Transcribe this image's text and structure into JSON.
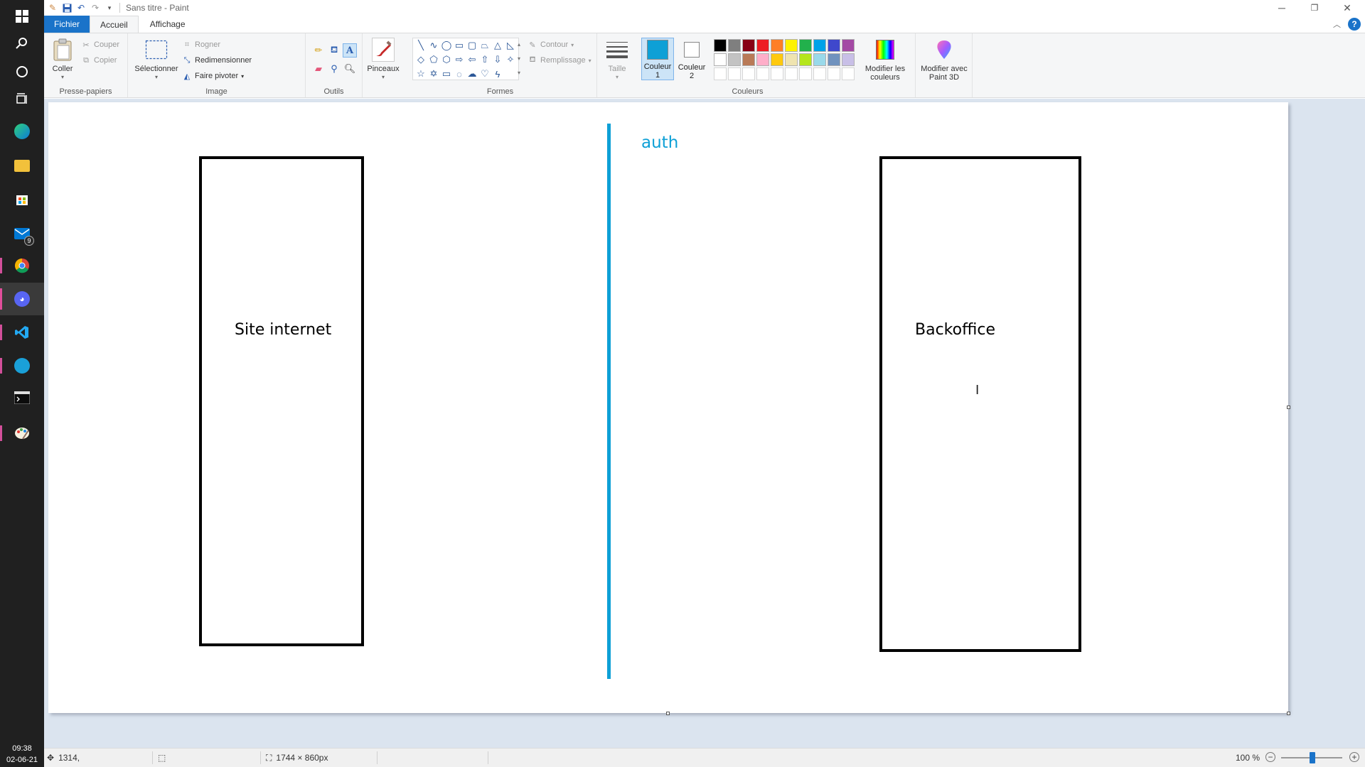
{
  "taskbar": {
    "icons": [
      {
        "name": "windows-start-icon"
      },
      {
        "name": "search-icon"
      },
      {
        "name": "cortana-icon"
      },
      {
        "name": "task-view-icon"
      },
      {
        "name": "edge-icon"
      },
      {
        "name": "file-explorer-icon"
      },
      {
        "name": "store-icon"
      },
      {
        "name": "mail-icon",
        "badge": "9"
      },
      {
        "name": "chrome-icon"
      },
      {
        "name": "discord-icon"
      },
      {
        "name": "vscode-icon"
      },
      {
        "name": "app-icon"
      },
      {
        "name": "terminal-icon"
      },
      {
        "name": "paint-icon"
      }
    ],
    "time": "09:38",
    "date": "02-06-21"
  },
  "window": {
    "title": "Sans titre - Paint"
  },
  "tabs": {
    "file": "Fichier",
    "home": "Accueil",
    "view": "Affichage"
  },
  "ribbon": {
    "clipboard": {
      "paste": "Coller",
      "cut": "Couper",
      "copy": "Copier",
      "label": "Presse-papiers"
    },
    "image": {
      "select": "Sélectionner",
      "crop": "Rogner",
      "resize": "Redimensionner",
      "rotate": "Faire pivoter",
      "label": "Image"
    },
    "tools": {
      "label": "Outils"
    },
    "brushes": {
      "label": "Pinceaux"
    },
    "shapes": {
      "outline": "Contour",
      "fill": "Remplissage",
      "label": "Formes"
    },
    "size": {
      "label": "Taille"
    },
    "colors": {
      "color1": "Couleur",
      "color1_num": "1",
      "color2": "Couleur",
      "color2_num": "2",
      "edit_colors_1": "Modifier les",
      "edit_colors_2": "couleurs",
      "paint3d_1": "Modifier avec",
      "paint3d_2": "Paint 3D",
      "label": "Couleurs",
      "color1_value": "#0ea0d6",
      "color2_value": "#ffffff",
      "palette_row1": [
        "#000000",
        "#7f7f7f",
        "#880015",
        "#ed1c24",
        "#ff7f27",
        "#fff200",
        "#22b14c",
        "#00a2e8",
        "#3f48cc",
        "#a349a4"
      ],
      "palette_row2": [
        "#ffffff",
        "#c3c3c3",
        "#b97a57",
        "#ffaec9",
        "#ffc90e",
        "#efe4b0",
        "#b5e61d",
        "#99d9ea",
        "#7092be",
        "#c8bfe7"
      ]
    }
  },
  "canvas": {
    "left_box_label": "Site internet",
    "right_box_label": "Backoffice",
    "divider_label": "auth",
    "divider_color": "#0ea0d6"
  },
  "statusbar": {
    "cursor_pos": "1314,",
    "canvas_size": "1744 × 860px",
    "zoom": "100 %",
    "zoom_minus": "−",
    "zoom_plus": "+"
  }
}
